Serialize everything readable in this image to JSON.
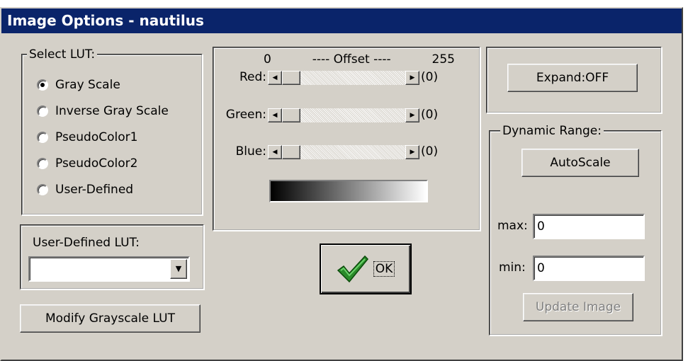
{
  "window": {
    "title": "Image Options - nautilus"
  },
  "lut": {
    "legend": "Select LUT:",
    "options": [
      {
        "label": "Gray Scale",
        "checked": true
      },
      {
        "label": "Inverse Gray Scale",
        "checked": false
      },
      {
        "label": "PseudoColor1",
        "checked": false
      },
      {
        "label": "PseudoColor2",
        "checked": false
      },
      {
        "label": "User-Defined",
        "checked": false
      }
    ]
  },
  "user_lut": {
    "label": "User-Defined LUT:",
    "value": ""
  },
  "modify_button": "Modify Grayscale LUT",
  "offset": {
    "min_label": "0",
    "header": "----  Offset ----",
    "max_label": "255",
    "channels": [
      {
        "label": "Red:",
        "value": "(0)"
      },
      {
        "label": "Green:",
        "value": "(0)"
      },
      {
        "label": "Blue:",
        "value": "(0)"
      }
    ]
  },
  "ok_button": "OK",
  "expand_button": "Expand:OFF",
  "dynamic_range": {
    "legend": "Dynamic Range:",
    "autoscale_button": "AutoScale",
    "max_label": "max:",
    "max_value": "0",
    "min_label": "min:",
    "min_value": "0",
    "update_button": "Update Image"
  },
  "colors": {
    "titlebar": "#0a246a",
    "face": "#d4d0c8",
    "check": "#2a8a2a"
  }
}
